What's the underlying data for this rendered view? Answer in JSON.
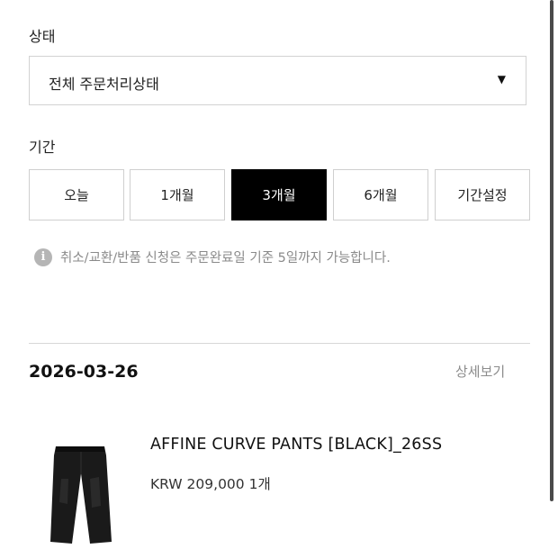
{
  "status": {
    "label": "상태",
    "selected": "전체 주문처리상태"
  },
  "period": {
    "label": "기간",
    "options": [
      "오늘",
      "1개월",
      "3개월",
      "6개월",
      "기간설정"
    ],
    "active_index": 2
  },
  "notice": {
    "text": "취소/교환/반품 신청은 주문완료일 기준 5일까지 가능합니다."
  },
  "order": {
    "date": "2026-03-26",
    "detail_link": "상세보기",
    "product": {
      "name": "AFFINE CURVE PANTS [BLACK]_26SS",
      "price_line": "KRW 209,000 1개"
    }
  }
}
